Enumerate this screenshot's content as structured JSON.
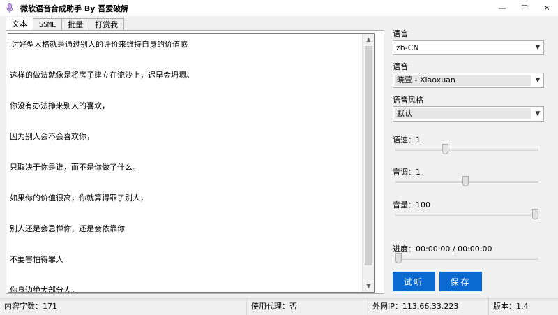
{
  "window": {
    "title": "微软语音合成助手 By 吾爱破解",
    "app_icon": "microphone-icon",
    "minimize_glyph": "—",
    "maximize_glyph": "☐",
    "close_glyph": "✕"
  },
  "tabs": [
    {
      "label": "文本",
      "active": true
    },
    {
      "label": "SSML",
      "active": false
    },
    {
      "label": "批量",
      "active": false
    },
    {
      "label": "打赏我",
      "active": false
    }
  ],
  "editor": {
    "lines": [
      "讨好型人格就是通过别人的评价来维持自身的价值感",
      "",
      "这样的做法就像是将房子建立在流沙上，迟早会坍塌。",
      "",
      "你没有办法挣来别人的喜欢，",
      "",
      "因为别人会不会喜欢你，",
      "",
      "只取决于你是谁，而不是你做了什么。",
      "",
      "如果你的价值很高，你就算得罪了别人，",
      "",
      "别人还是会忌惮你，还是会依靠你",
      "",
      "不要害怕得罪人",
      "",
      "你身边绝大部分人，"
    ],
    "scroll_up_glyph": "▲",
    "scroll_down_glyph": "▼"
  },
  "settings": {
    "language": {
      "label": "语言",
      "value": "zh-CN"
    },
    "voice": {
      "label": "语音",
      "value": "晓萱 - Xiaoxuan"
    },
    "style": {
      "label": "语音风格",
      "value": "默认"
    },
    "rate": {
      "label": "语速：1",
      "level": 0.34
    },
    "pitch": {
      "label": "音调：1",
      "level": 0.49
    },
    "volume": {
      "label": "音量：100",
      "level": 1.0
    },
    "progress": {
      "label": "进度：00:00:00 / 00:00:00",
      "level": 0.0
    },
    "chevron": "▼"
  },
  "buttons": {
    "listen": "试听",
    "save": "保存"
  },
  "status": {
    "char_count": "内容字数：171",
    "proxy": "使用代理：否",
    "ip": "外网IP：113.66.33.223",
    "version": "版本：1.4"
  },
  "colors": {
    "accent": "#0a6ad2",
    "background": "#f0f0f0"
  }
}
